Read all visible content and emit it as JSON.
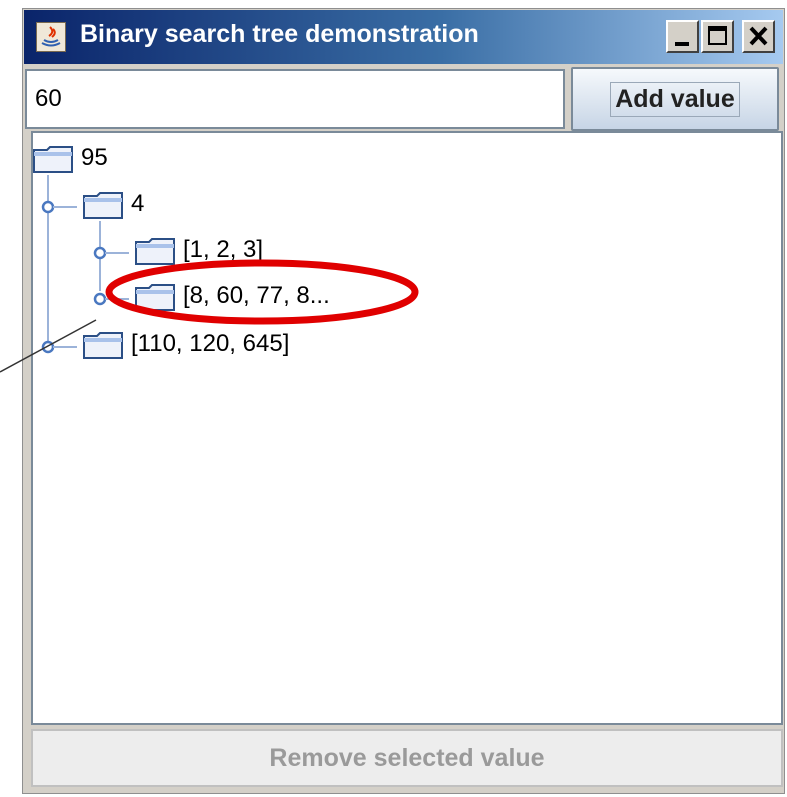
{
  "window": {
    "title": "Binary search tree demonstration",
    "title_buttons": [
      "minimize",
      "maximize",
      "close"
    ]
  },
  "input": {
    "value": "60"
  },
  "buttons": {
    "add_label": "Add value",
    "remove_label": "Remove selected value",
    "remove_enabled": false
  },
  "tree": {
    "root": "95",
    "left": "4",
    "left_left": "[1, 2, 3]",
    "left_right": "[8, 60, 77, 8...",
    "right": "[110, 120, 645]"
  },
  "annotation": {
    "type": "ellipse",
    "color": "#e00000",
    "highlights": "tree.left_right"
  },
  "colors": {
    "title_start": "#0a246a",
    "title_end": "#a6caf0",
    "tree_line": "#9cb3d9"
  }
}
